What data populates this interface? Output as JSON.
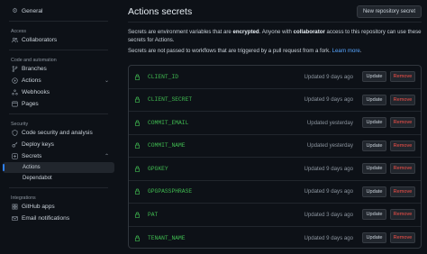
{
  "sidebar": {
    "general": "General",
    "sections": {
      "access": "Access",
      "code": "Code and automation",
      "security": "Security",
      "integrations": "Integrations"
    },
    "collaborators": "Collaborators",
    "branches": "Branches",
    "actions": "Actions",
    "webhooks": "Webhooks",
    "pages": "Pages",
    "code_security": "Code security and analysis",
    "deploy_keys": "Deploy keys",
    "secrets": "Secrets",
    "secrets_sub": [
      "Actions",
      "Dependabot"
    ],
    "github_apps": "GitHub apps",
    "email_notifications": "Email notifications"
  },
  "main": {
    "title": "Actions secrets",
    "new_button": "New repository secret",
    "desc1_pre": "Secrets are environment variables that are ",
    "desc1_b1": "encrypted",
    "desc1_mid": ". Anyone with ",
    "desc1_b2": "collaborator",
    "desc1_post": " access to this repository can use these secrets for Actions.",
    "desc2_pre": "Secrets are not passed to workflows that are triggered by a pull request from a fork. ",
    "desc2_link": "Learn more",
    "desc2_post": "."
  },
  "secrets": [
    {
      "name": "CLIENT_ID",
      "updated": "Updated 9 days ago"
    },
    {
      "name": "CLIENT_SECRET",
      "updated": "Updated 9 days ago"
    },
    {
      "name": "COMMIT_EMAIL",
      "updated": "Updated yesterday"
    },
    {
      "name": "COMMIT_NAME",
      "updated": "Updated yesterday"
    },
    {
      "name": "GPGKEY",
      "updated": "Updated 9 days ago"
    },
    {
      "name": "GPGPASSPHRASE",
      "updated": "Updated 9 days ago"
    },
    {
      "name": "PAT",
      "updated": "Updated 3 days ago"
    },
    {
      "name": "TENANT_NAME",
      "updated": "Updated 9 days ago"
    }
  ],
  "buttons": {
    "update": "Update",
    "remove": "Remove"
  },
  "colors": {
    "accent": "#2f81f7",
    "secret_name": "#3fb950",
    "remove": "#f85149",
    "background": "#0d1117"
  }
}
